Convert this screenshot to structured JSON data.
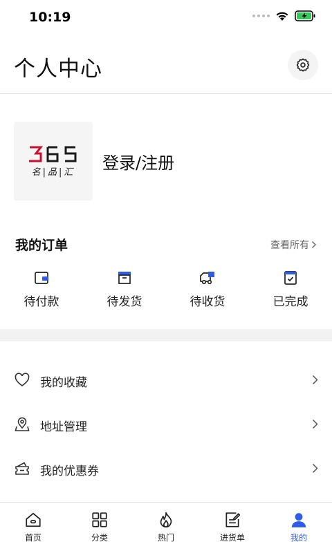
{
  "status": {
    "time": "10:19"
  },
  "header": {
    "title": "个人中心"
  },
  "profile": {
    "logo_mark": "365",
    "logo_sub": "名|品|汇",
    "login_label": "登录/注册"
  },
  "orders": {
    "title": "我的订单",
    "view_all": "查看所有",
    "items": [
      {
        "label": "待付款",
        "icon": "wallet-icon"
      },
      {
        "label": "待发货",
        "icon": "box-icon"
      },
      {
        "label": "待收货",
        "icon": "truck-icon"
      },
      {
        "label": "已完成",
        "icon": "checkbox-icon"
      }
    ]
  },
  "menu": [
    {
      "label": "我的收藏",
      "icon": "heart-icon"
    },
    {
      "label": "地址管理",
      "icon": "location-icon"
    },
    {
      "label": "我的优惠券",
      "icon": "coupon-icon"
    }
  ],
  "tabs": [
    {
      "label": "首页",
      "icon": "home-icon"
    },
    {
      "label": "分类",
      "icon": "grid-icon"
    },
    {
      "label": "热门",
      "icon": "flame-icon"
    },
    {
      "label": "进货单",
      "icon": "order-list-icon"
    },
    {
      "label": "我的",
      "icon": "user-icon",
      "active": true
    }
  ],
  "colors": {
    "accent": "#2f5bea",
    "logo_red": "#c8102e",
    "icon_blue": "#2f5bea"
  }
}
